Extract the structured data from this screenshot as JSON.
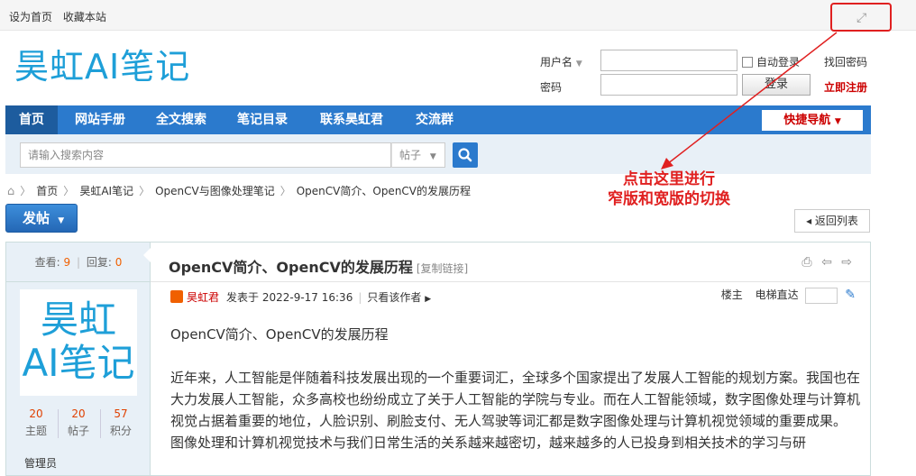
{
  "topbar": {
    "set_home": "设为首页",
    "bookmark": "收藏本站",
    "widen_icon": "expand-icon"
  },
  "header": {
    "logo": "昊虹AI笔记",
    "username_label": "用户名",
    "password_label": "密码",
    "auto_login": "自动登录",
    "find_password": "找回密码",
    "login": "登录",
    "register": "立即注册"
  },
  "nav": {
    "items": [
      "首页",
      "网站手册",
      "全文搜索",
      "笔记目录",
      "联系昊虹君",
      "交流群"
    ],
    "quick_nav": "快捷导航"
  },
  "search": {
    "placeholder": "请输入搜索内容",
    "type": "帖子"
  },
  "breadcrumb": [
    "首页",
    "昊虹AI笔记",
    "OpenCV与图像处理笔记",
    "OpenCV简介、OpenCV的发展历程"
  ],
  "annotation": {
    "line1": "点击这里进行",
    "line2": "窄版和宽版的切换"
  },
  "actions": {
    "post": "发帖",
    "back": "返回列表"
  },
  "sidebar": {
    "views_label": "查看:",
    "views": "9",
    "replies_label": "回复:",
    "replies": "0",
    "avatar_line1": "昊虹",
    "avatar_line2": "AI笔记",
    "topics": "20",
    "topics_label": "主题",
    "posts": "20",
    "posts_label": "帖子",
    "points": "57",
    "points_label": "积分",
    "role": "管理员"
  },
  "post": {
    "title": "OpenCV简介、OpenCV的发展历程",
    "copy_link": "[复制链接]",
    "author": "昊虹君",
    "posted_at": "发表于 2022-9-17 16:36",
    "only_author": "只看该作者",
    "floor": "楼主",
    "elevator": "电梯直达",
    "para_title": "OpenCV简介、OpenCV的发展历程",
    "para1": "近年来，人工智能是伴随着科技发展出现的一个重要词汇，全球多个国家提出了发展人工智能的规划方案。我国也在大力发展人工智能，众多高校也纷纷成立了关于人工智能的学院与专业。而在人工智能领域，数字图像处理与计算机视觉占据着重要的地位，人脸识别、刷脸支付、无人驾驶等词汇都是数字图像处理与计算机视觉领域的重要成果。",
    "para2": "图像处理和计算机视觉技术与我们日常生活的关系越来越密切，越来越多的人已投身到相关技术的学习与研"
  }
}
